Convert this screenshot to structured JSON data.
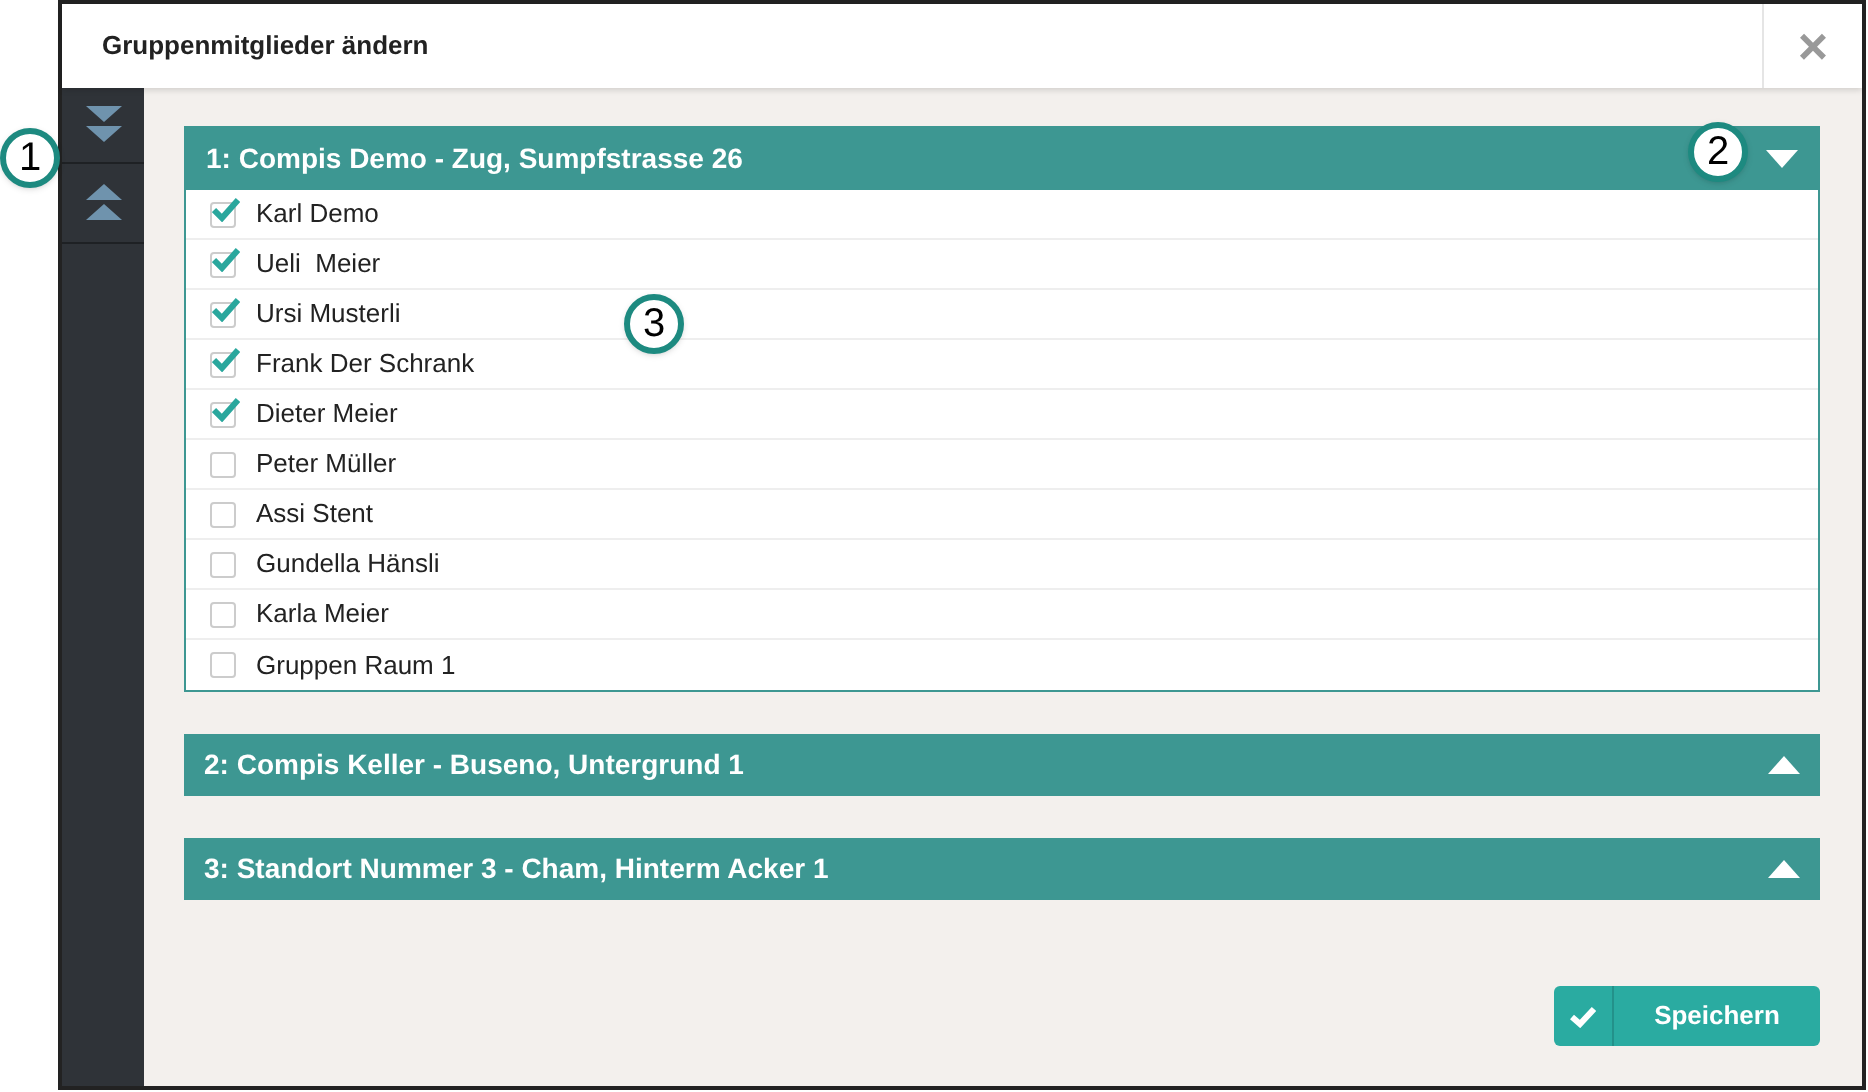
{
  "dialog": {
    "title": "Gruppenmitglieder ändern",
    "close": "×"
  },
  "groups": [
    {
      "title": "1: Compis Demo - Zug, Sumpfstrasse 26",
      "expanded": true,
      "members": [
        {
          "name": "Karl Demo",
          "checked": true
        },
        {
          "name": "Ueli  Meier",
          "checked": true
        },
        {
          "name": "Ursi Musterli",
          "checked": true
        },
        {
          "name": "Frank Der Schrank",
          "checked": true
        },
        {
          "name": "Dieter Meier",
          "checked": true
        },
        {
          "name": "Peter Müller",
          "checked": false
        },
        {
          "name": "Assi Stent",
          "checked": false
        },
        {
          "name": "Gundella Hänsli",
          "checked": false
        },
        {
          "name": "Karla Meier",
          "checked": false
        },
        {
          "name": "Gruppen Raum 1",
          "checked": false
        }
      ]
    },
    {
      "title": "2: Compis Keller - Buseno, Untergrund 1",
      "expanded": false
    },
    {
      "title": "3: Standort Nummer 3 - Cham, Hinterm Acker 1",
      "expanded": false
    }
  ],
  "save_button": "Speichern",
  "callouts": [
    {
      "label": "1"
    },
    {
      "label": "2"
    },
    {
      "label": "3"
    }
  ]
}
